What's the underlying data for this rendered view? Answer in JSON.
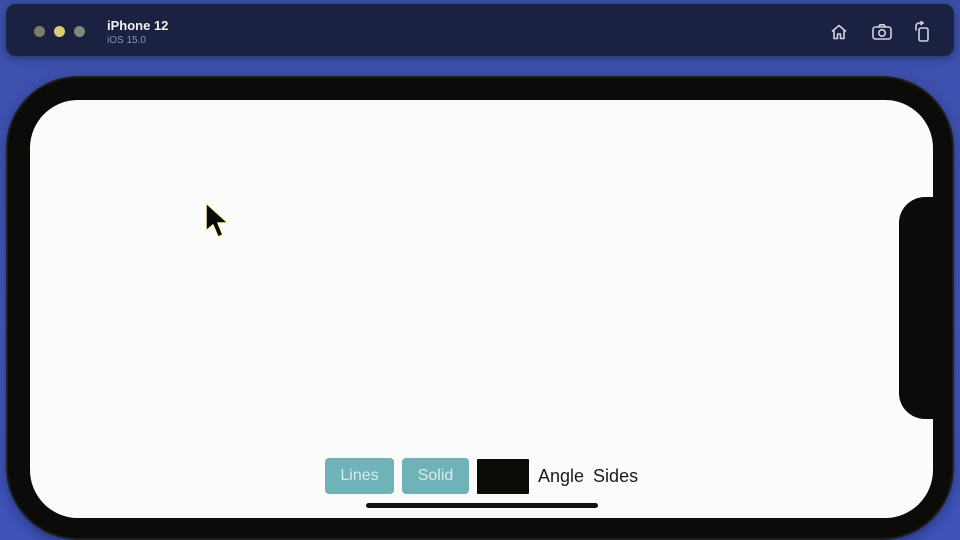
{
  "simulator": {
    "device_name": "iPhone 12",
    "os_version": "iOS 15.0",
    "toolbar_icons": [
      "home-icon",
      "screenshot-icon",
      "rotate-icon"
    ]
  },
  "app": {
    "toolbar": {
      "lines_label": "Lines",
      "solid_label": "Solid",
      "color_value": "#0c0c06",
      "angle_label": "Angle",
      "sides_label": "Sides"
    }
  },
  "colors": {
    "button_bg": "#6fb3b8",
    "button_text": "#d7ecee",
    "screen_bg": "#fbfbfb",
    "titlebar_bg": "#1b2140"
  }
}
